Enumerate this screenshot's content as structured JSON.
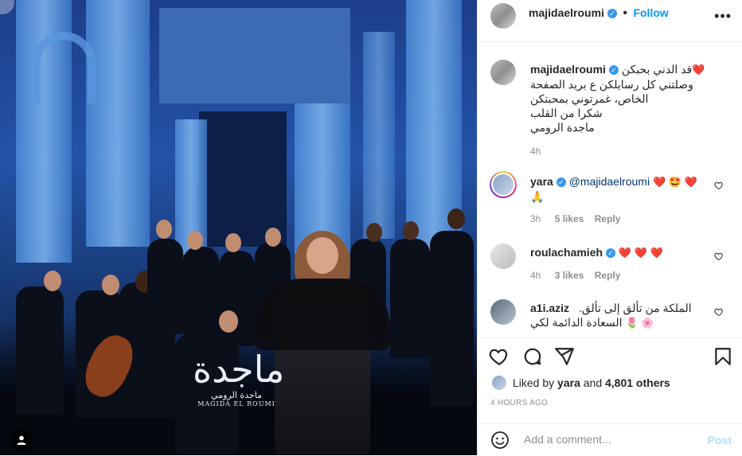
{
  "post": {
    "author": "majidaelroumi",
    "follow_label": "Follow",
    "more_label": "•••",
    "caption": {
      "line1_text": "قد الدني بحبكن",
      "line1_emoji": "❤️",
      "lines": [
        "وصلتني كل رسايلكن ع بريد الصفحة",
        "الخاص، غمرتوني بمحبتكن",
        "شكرا من القلب",
        "ماجدة الرومي"
      ],
      "time": "4h"
    },
    "comments": [
      {
        "user": "yara",
        "verified": true,
        "mention": "@majidaelroumi",
        "emoji_line1": "❤️ 🤩 ❤️",
        "emoji_line2": "🙏",
        "time": "3h",
        "likes": "5 likes",
        "reply": "Reply"
      },
      {
        "user": "roulachamieh",
        "verified": true,
        "emoji_line1": "❤️ ❤️ ❤️",
        "time": "4h",
        "likes": "3 likes",
        "reply": "Reply"
      },
      {
        "user": "a1i.aziz",
        "verified": false,
        "line1": "الملكة من تألق إلى تألق.",
        "line2_text": "السعادة الدائمة لكي",
        "line2_emoji": "🌷 🌸"
      }
    ],
    "liked_by_prefix": "Liked by ",
    "liked_by_user": "yara",
    "liked_by_mid": " and ",
    "liked_by_others": "4,801 others",
    "time_ago": "4 HOURS AGO",
    "add_comment_placeholder": "Add a comment...",
    "post_label": "Post"
  },
  "photo": {
    "watermark_mark": "ماجدة",
    "watermark_arabic": "ماجدة الرومي",
    "watermark_english": "MAGIDA EL ROUMI"
  },
  "colors": {
    "link_blue": "#0095f6",
    "verified_blue": "#3897f0",
    "muted_gray": "#8e8e8e",
    "post_disabled": "#b2dffc"
  },
  "icons": [
    "verified-icon",
    "more-icon",
    "heart-icon",
    "comment-icon",
    "share-icon",
    "bookmark-icon",
    "emoji-icon",
    "user-tag-icon"
  ]
}
